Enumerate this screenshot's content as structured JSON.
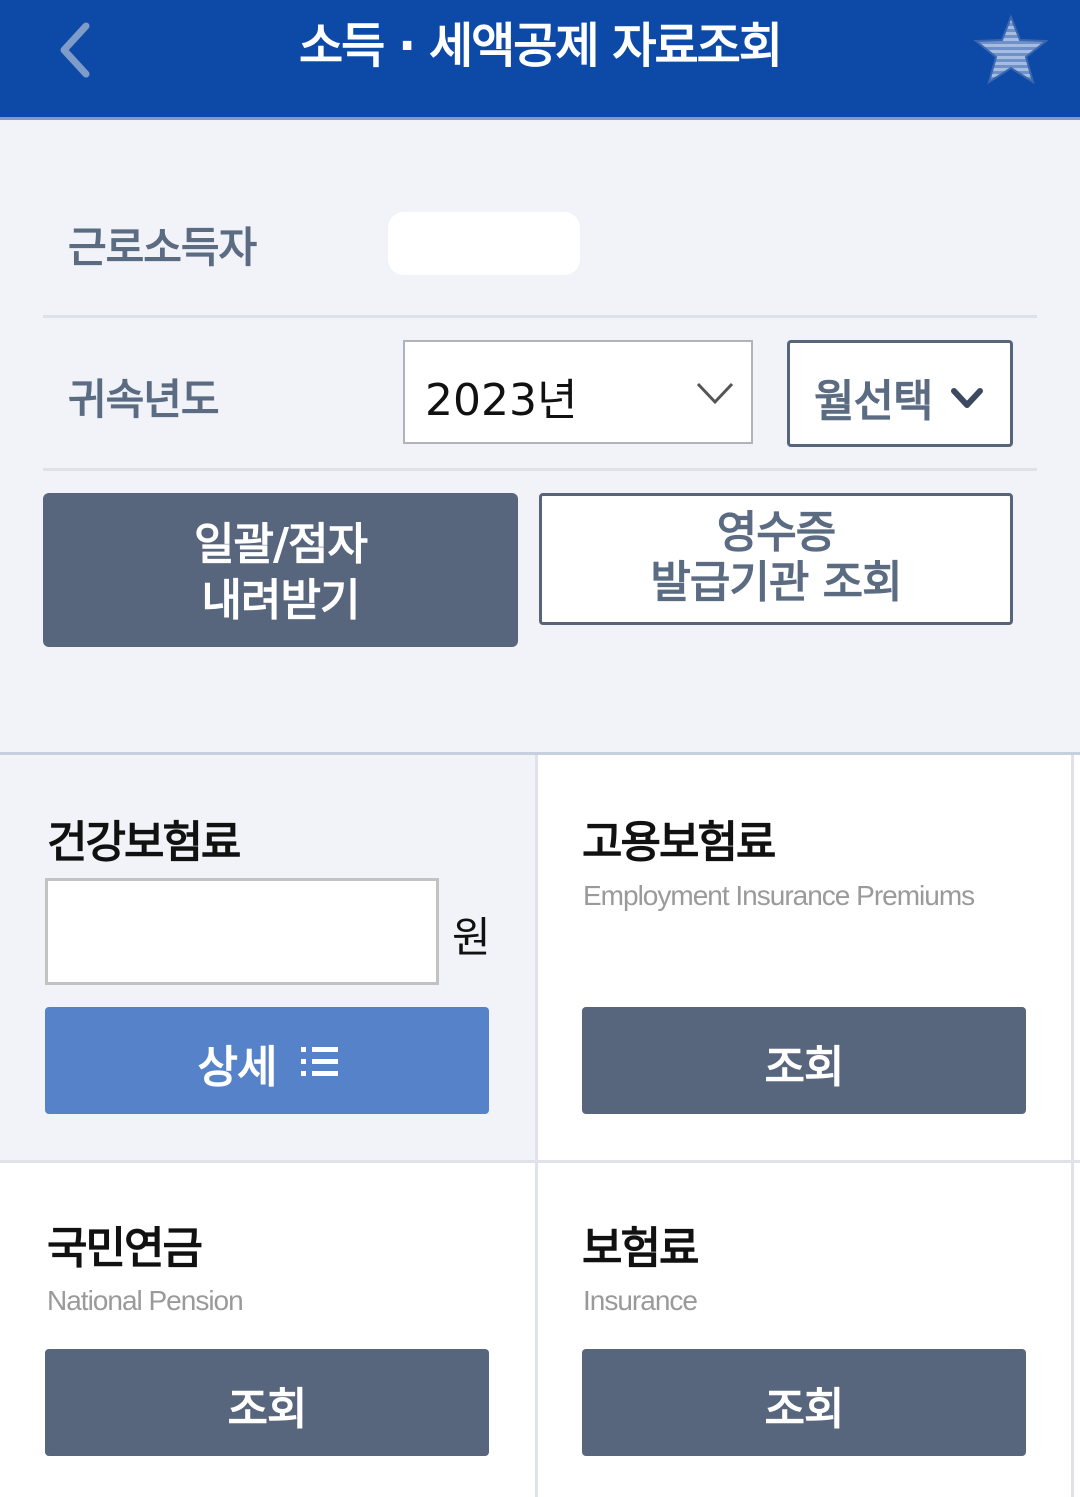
{
  "header": {
    "title": "소득 · 세액공제 자료조회",
    "back_icon": "chevron-left-icon",
    "favorite_icon": "star-icon",
    "bg_color": "#0d4aa8"
  },
  "taxpayer": {
    "label": "근로소득자",
    "name_value": ""
  },
  "year_filter": {
    "label": "귀속년도",
    "year_value": "2023년",
    "month_value": "월선택"
  },
  "actions": {
    "bulk_download_line1": "일괄/점자",
    "bulk_download_line2": "내려받기",
    "receipt_issuer_line1": "영수증",
    "receipt_issuer_line2": "발급기관 조회"
  },
  "cards": {
    "health": {
      "title": "건강보험료",
      "amount_value": "",
      "unit": "원",
      "button_label": "상세",
      "button_icon": "list-icon"
    },
    "employment": {
      "title": "고용보험료",
      "subtitle": "Employment Insurance Premiums",
      "button_label": "조회"
    },
    "pension": {
      "title": "국민연금",
      "subtitle": "National Pension",
      "button_label": "조회"
    },
    "insurance": {
      "title": "보험료",
      "subtitle": "Insurance",
      "button_label": "조회"
    }
  }
}
